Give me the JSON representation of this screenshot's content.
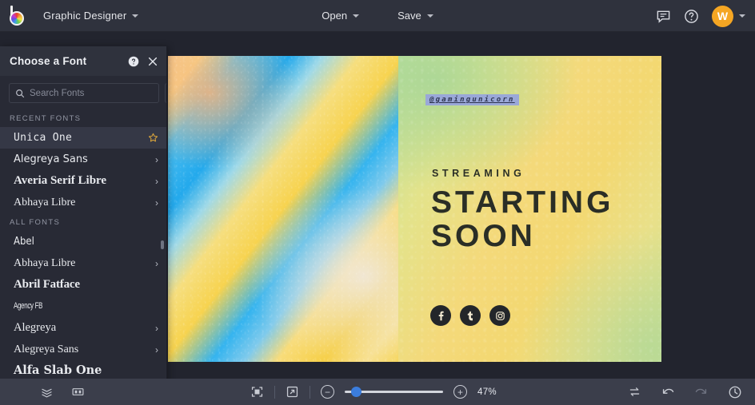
{
  "topbar": {
    "logo_name": "brand-logo",
    "document_title": "Graphic Designer",
    "menus": [
      {
        "label": "Open",
        "name": "open-menu"
      },
      {
        "label": "Save",
        "name": "save-menu"
      }
    ],
    "comment_icon": "comment-icon",
    "help_icon": "help-icon",
    "avatar_initial": "W",
    "avatar_color": "#f5a623"
  },
  "font_panel": {
    "title": "Choose a Font",
    "help_icon": "help-icon",
    "close_icon": "close-icon",
    "search": {
      "placeholder": "Search Fonts",
      "value": "",
      "icon": "search-icon"
    },
    "favorites_button": "★",
    "add_button": "+",
    "recent_label": "RECENT FONTS",
    "recent_fonts": [
      {
        "label": "Unica One",
        "selected": true,
        "has_star": true,
        "has_chevron": false,
        "style": "f-unica"
      },
      {
        "label": "Alegreya Sans",
        "selected": false,
        "has_star": false,
        "has_chevron": true,
        "style": "f-alegsans"
      },
      {
        "label": "Averia Serif Libre",
        "selected": false,
        "has_star": false,
        "has_chevron": true,
        "style": "f-averia"
      },
      {
        "label": "Abhaya Libre",
        "selected": false,
        "has_star": false,
        "has_chevron": true,
        "style": "f-abhaya"
      }
    ],
    "all_label": "ALL FONTS",
    "all_fonts": [
      {
        "label": "Abel",
        "has_chevron": false,
        "style": "f-abel"
      },
      {
        "label": "Abhaya Libre",
        "has_chevron": true,
        "style": "f-abhaya"
      },
      {
        "label": "Abril Fatface",
        "has_chevron": false,
        "style": "f-abril"
      },
      {
        "label": "Agency FB",
        "has_chevron": false,
        "style": "f-agency"
      },
      {
        "label": "Alegreya",
        "has_chevron": true,
        "style": "f-alegreya"
      },
      {
        "label": "Alegreya Sans",
        "has_chevron": true,
        "style": "f-alegsans2"
      },
      {
        "label": "Alfa Slab One",
        "has_chevron": false,
        "style": "f-alfa"
      }
    ]
  },
  "canvas": {
    "handle_text": "@gamingunicorn",
    "kicker": "STREAMING",
    "headline": "STARTING SOON",
    "socials": [
      {
        "name": "facebook-icon",
        "glyph": "f"
      },
      {
        "name": "tumblr-icon",
        "glyph": "t"
      },
      {
        "name": "instagram-icon",
        "glyph": "◎"
      }
    ]
  },
  "bottombar": {
    "layers_icon": "layers-icon",
    "pages_icon": "pages-icon",
    "fit_icon": "fit-to-screen-icon",
    "expand_icon": "expand-icon",
    "zoom_out": "−",
    "zoom_in": "+",
    "zoom_percent": "47%",
    "zoom_value": 47,
    "swap_icon": "swap-icon",
    "undo_icon": "undo-icon",
    "redo_icon": "redo-icon",
    "history_icon": "history-icon"
  }
}
